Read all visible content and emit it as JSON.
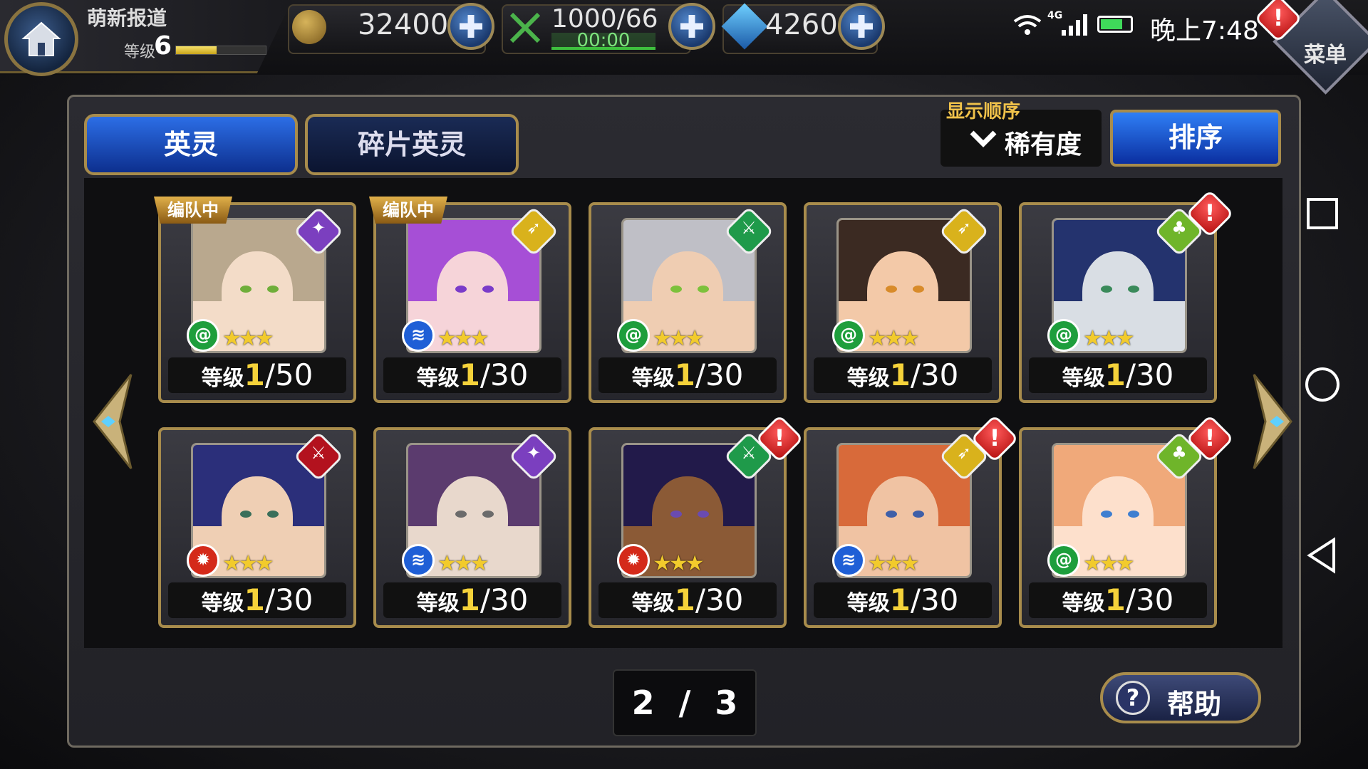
{
  "player": {
    "name": "萌新报道",
    "level_label": "等级",
    "level": "6",
    "xp_fraction": 0.45
  },
  "resources": {
    "coins": "32400",
    "stamina": "1000/66",
    "stamina_timer": "00:00",
    "gems": "4260"
  },
  "status_bar": {
    "time": "晚上7:48",
    "network": "4G"
  },
  "menu": {
    "label": "菜单"
  },
  "tabs": [
    {
      "label": "英灵",
      "active": true
    },
    {
      "label": "碎片英灵",
      "active": false
    }
  ],
  "sort": {
    "label": "显示顺序",
    "value": "稀有度",
    "button": "排序"
  },
  "party_tag": "编队中",
  "cards": [
    {
      "level_label": "等级",
      "level": "1",
      "max": "/50",
      "class": "mage",
      "element": "wind",
      "stars": 3,
      "in_party": true,
      "alert": false,
      "hair": "#b9a88e",
      "face": "#f3dcc8",
      "eye": "#6fae3a",
      "class_color": "#7b3fbf",
      "elem_color": "#1e9e3c"
    },
    {
      "level_label": "等级",
      "level": "1",
      "max": "/30",
      "class": "archer",
      "element": "water",
      "stars": 3,
      "in_party": true,
      "alert": false,
      "hair": "#a64fd6",
      "face": "#f6d4d9",
      "eye": "#7a3bc9",
      "class_color": "#d9b21c",
      "elem_color": "#1f5fd6"
    },
    {
      "level_label": "等级",
      "level": "1",
      "max": "/30",
      "class": "swordsman",
      "element": "wind",
      "stars": 3,
      "in_party": false,
      "alert": false,
      "hair": "#bfbfc6",
      "face": "#efcdb2",
      "eye": "#7cc13c",
      "class_color": "#1f9a4a",
      "elem_color": "#1e9e3c"
    },
    {
      "level_label": "等级",
      "level": "1",
      "max": "/30",
      "class": "archer",
      "element": "wind",
      "stars": 3,
      "in_party": false,
      "alert": false,
      "hair": "#3b2a22",
      "face": "#f3c9a8",
      "eye": "#d88b2a",
      "class_color": "#d9b21c",
      "elem_color": "#1e9e3c"
    },
    {
      "level_label": "等级",
      "level": "1",
      "max": "/30",
      "class": "support",
      "element": "wind",
      "stars": 3,
      "in_party": false,
      "alert": true,
      "hair": "#24336e",
      "face": "#d9dee4",
      "eye": "#3a8a5a",
      "class_color": "#6fb52a",
      "elem_color": "#1e9e3c"
    },
    {
      "level_label": "等级",
      "level": "1",
      "max": "/30",
      "class": "swordsman",
      "element": "fire",
      "stars": 3,
      "in_party": false,
      "alert": false,
      "hair": "#2b2f7a",
      "face": "#efcfb4",
      "eye": "#3a6f5a",
      "class_color": "#b3121e",
      "elem_color": "#d42a1a"
    },
    {
      "level_label": "等级",
      "level": "1",
      "max": "/30",
      "class": "mage",
      "element": "water",
      "stars": 3,
      "in_party": false,
      "alert": false,
      "hair": "#5b3b6e",
      "face": "#e8d8cc",
      "eye": "#6b6b6b",
      "class_color": "#7b3fbf",
      "elem_color": "#1f5fd6"
    },
    {
      "level_label": "等级",
      "level": "1",
      "max": "/30",
      "class": "swordsman",
      "element": "fire",
      "stars": 3,
      "in_party": false,
      "alert": true,
      "hair": "#221a4a",
      "face": "#8b5a36",
      "eye": "#6a4bb0",
      "class_color": "#1f9a4a",
      "elem_color": "#d42a1a"
    },
    {
      "level_label": "等级",
      "level": "1",
      "max": "/30",
      "class": "archer",
      "element": "water",
      "stars": 3,
      "in_party": false,
      "alert": true,
      "hair": "#d86a3a",
      "face": "#f0c3a3",
      "eye": "#3f5fa8",
      "class_color": "#d9b21c",
      "elem_color": "#1f5fd6"
    },
    {
      "level_label": "等级",
      "level": "1",
      "max": "/30",
      "class": "support",
      "element": "wind",
      "stars": 3,
      "in_party": false,
      "alert": true,
      "hair": "#f0a97a",
      "face": "#fde0cc",
      "eye": "#3f7fd0",
      "class_color": "#6fb52a",
      "elem_color": "#1e9e3c"
    }
  ],
  "pager": {
    "current": "2",
    "separator": "/",
    "total": "3"
  },
  "help": {
    "label": "帮助"
  }
}
